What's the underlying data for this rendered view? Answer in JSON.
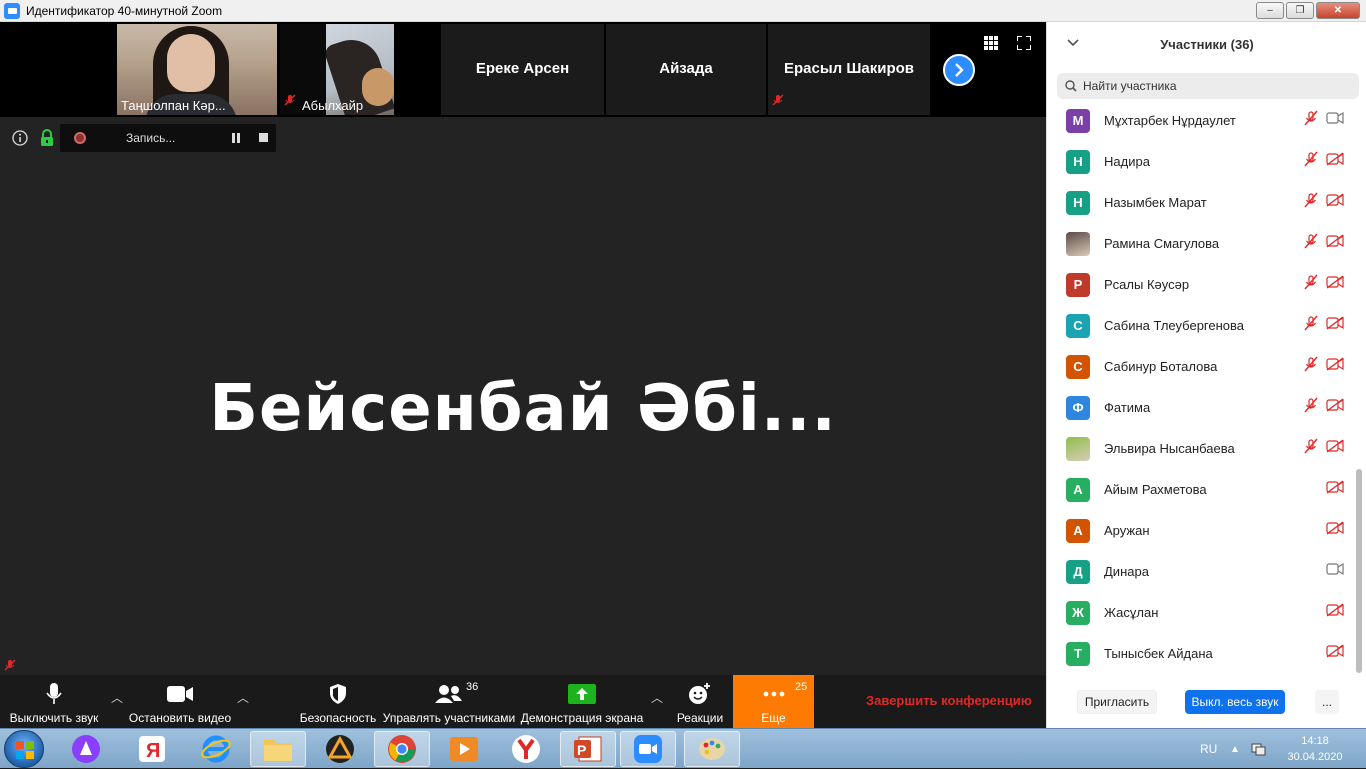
{
  "window": {
    "title": "Идентификатор 40-минутной Zoom",
    "min": "‒",
    "restore": "❐",
    "close": "✕"
  },
  "thumbnails": [
    {
      "name": "Таңшолпан Кәр...",
      "type": "video"
    },
    {
      "name": "Абылхайр",
      "type": "video",
      "muted": true
    },
    {
      "name": "Ереке Арсен",
      "type": "name"
    },
    {
      "name": "Айзада",
      "type": "name"
    },
    {
      "name": "Ерасыл Шакиров",
      "type": "name",
      "muted": true
    }
  ],
  "recording": {
    "label": "Запись..."
  },
  "speaker": {
    "name": "Бейсенбай Әбі..."
  },
  "toolbar": {
    "mute_label": "Выключить звук",
    "video_label": "Остановить видео",
    "security_label": "Безопасность",
    "participants_label": "Управлять участниками",
    "participants_count": "36",
    "share_label": "Демонстрация экрана",
    "reactions_label": "Реакции",
    "more_label": "Еще",
    "more_count": "25",
    "end_label": "Завершить конференцию",
    "accent_share": "#1cb31c",
    "accent_more": "#ff7a00",
    "accent_end": "#e02828"
  },
  "panel": {
    "title": "Участники (36)",
    "search_placeholder": "Найти участника",
    "invite_label": "Пригласить",
    "mute_all_label": "Выкл. весь звук",
    "more_label": "..."
  },
  "participants": [
    {
      "initial": "М",
      "name": "Мұхтарбек Нұрдаулет",
      "color": "#7b3fa8",
      "mic": "muted",
      "cam": "on"
    },
    {
      "initial": "Н",
      "name": "Надира",
      "color": "#16a085",
      "mic": "muted",
      "cam": "off"
    },
    {
      "initial": "Н",
      "name": "Назымбек Марат",
      "color": "#16a085",
      "mic": "muted",
      "cam": "off"
    },
    {
      "initial": "",
      "name": "Рамина Смагулова",
      "color": "#5a4a44",
      "mic": "muted",
      "cam": "off",
      "photo": true
    },
    {
      "initial": "Р",
      "name": "Рсалы Кәусәр",
      "color": "#c0392b",
      "mic": "muted",
      "cam": "off"
    },
    {
      "initial": "С",
      "name": "Сабина Тлеубергенова",
      "color": "#1aa3b0",
      "mic": "muted",
      "cam": "off"
    },
    {
      "initial": "С",
      "name": "Сабинур Боталова",
      "color": "#d35400",
      "mic": "muted",
      "cam": "off"
    },
    {
      "initial": "Ф",
      "name": "Фатима",
      "color": "#2e86de",
      "mic": "muted",
      "cam": "off"
    },
    {
      "initial": "",
      "name": "Эльвира Нысанбаева",
      "color": "#8fbf4a",
      "mic": "muted",
      "cam": "off",
      "photo": true
    },
    {
      "initial": "А",
      "name": "Айым Рахметова",
      "color": "#27ae60",
      "mic": "none",
      "cam": "off"
    },
    {
      "initial": "А",
      "name": "Аружан",
      "color": "#d35400",
      "mic": "none",
      "cam": "off"
    },
    {
      "initial": "Д",
      "name": "Динара",
      "color": "#16a085",
      "mic": "none",
      "cam": "on"
    },
    {
      "initial": "Ж",
      "name": "Жасұлан",
      "color": "#27ae60",
      "mic": "none",
      "cam": "off"
    },
    {
      "initial": "Т",
      "name": "Тынысбек Айдана",
      "color": "#27ae60",
      "mic": "none",
      "cam": "off"
    }
  ],
  "taskbar": {
    "apps": [
      "windows-explorer",
      "alice",
      "yandex",
      "internet-explorer",
      "file-manager",
      "alice-media",
      "chrome",
      "media-player",
      "yandex-browser",
      "powerpoint",
      "zoom",
      "paint"
    ],
    "lang": "RU",
    "time": "14:18",
    "date": "30.04.2020"
  }
}
